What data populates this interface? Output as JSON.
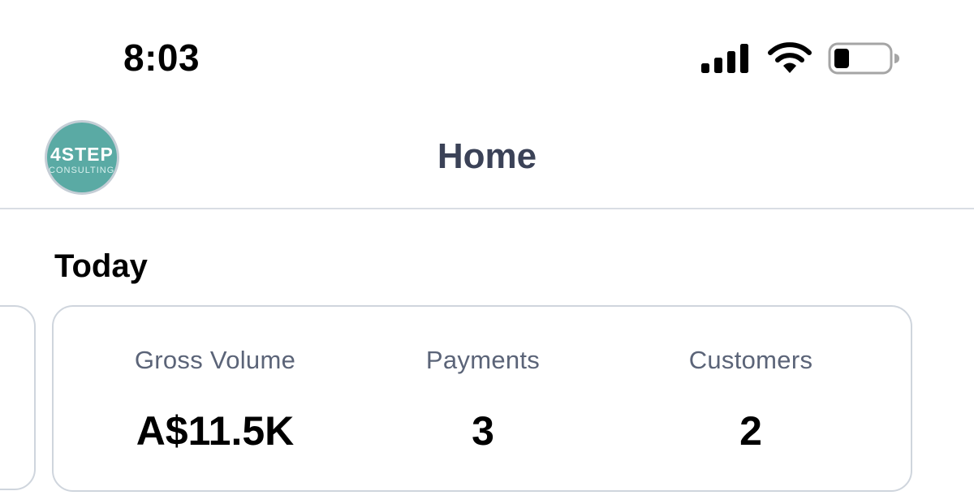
{
  "status_bar": {
    "time": "8:03",
    "icons": [
      "signal-icon",
      "wifi-icon",
      "battery-icon"
    ]
  },
  "nav": {
    "title": "Home",
    "avatar": {
      "line1": "4STEP",
      "line2": "CONSULTING",
      "color": "#5aaaa4"
    }
  },
  "section": {
    "title": "Today"
  },
  "stats": {
    "gross_volume": {
      "label": "Gross Volume",
      "value": "A$11.5K"
    },
    "payments": {
      "label": "Payments",
      "value": "3"
    },
    "customers": {
      "label": "Customers",
      "value": "2"
    }
  },
  "colors": {
    "title_text": "#3b4257",
    "label_text": "#5b6478",
    "card_border": "#cfd5dd",
    "divider": "#d9dde4"
  }
}
